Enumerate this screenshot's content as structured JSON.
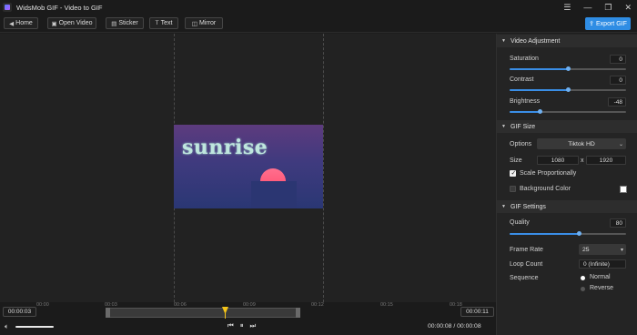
{
  "window": {
    "title": "WidsMob GIF - Video to GIF",
    "controls": {
      "menu": "☰",
      "minimize": "—",
      "restore": "❐",
      "close": "✕"
    }
  },
  "toolbar": {
    "home": "Home",
    "open_video": "Open Video",
    "sticker": "Sticker",
    "text": "Text",
    "mirror": "Mirror",
    "export": "Export GIF"
  },
  "preview": {
    "text": "sunrise"
  },
  "timeline": {
    "ticks": [
      "00:00",
      "00:03",
      "00:06",
      "00:09",
      "00:12",
      "00:15",
      "00:18"
    ],
    "start_time": "00:00:03",
    "end_time": "00:00:11",
    "current": "00:00:08",
    "separator": "/",
    "total": "00:00:08",
    "volume_level": 1.0
  },
  "video_adjustment": {
    "header": "Video Adjustment",
    "saturation": {
      "label": "Saturation",
      "value": "0",
      "level": 0.5
    },
    "contrast": {
      "label": "Contrast",
      "value": "0",
      "level": 0.5
    },
    "brightness": {
      "label": "Brightness",
      "value": "-48",
      "level": 0.26
    }
  },
  "gif_size": {
    "header": "GIF Size",
    "options_label": "Options",
    "options_value": "Tiktok HD",
    "size_label": "Size",
    "width": "1080",
    "x": "x",
    "height": "1920",
    "scale_label": "Scale Proportionally",
    "scale_checked": true,
    "bg_label": "Background Color",
    "bg_checked": false,
    "bg_color": "#ffffff"
  },
  "gif_settings": {
    "header": "GIF Settings",
    "quality_label": "Quality",
    "quality_value": "80",
    "quality_level": 0.6,
    "frame_rate_label": "Frame Rate",
    "frame_rate_value": "25",
    "loop_label": "Loop Count",
    "loop_value": "0 (Infinite)",
    "sequence_label": "Sequence",
    "normal": "Normal",
    "reverse": "Reverse",
    "selected_sequence": "Normal"
  },
  "colors": {
    "accent": "#2f8de4",
    "playhead": "#f5c518",
    "panel": "#242424",
    "canvas": "#222222"
  }
}
